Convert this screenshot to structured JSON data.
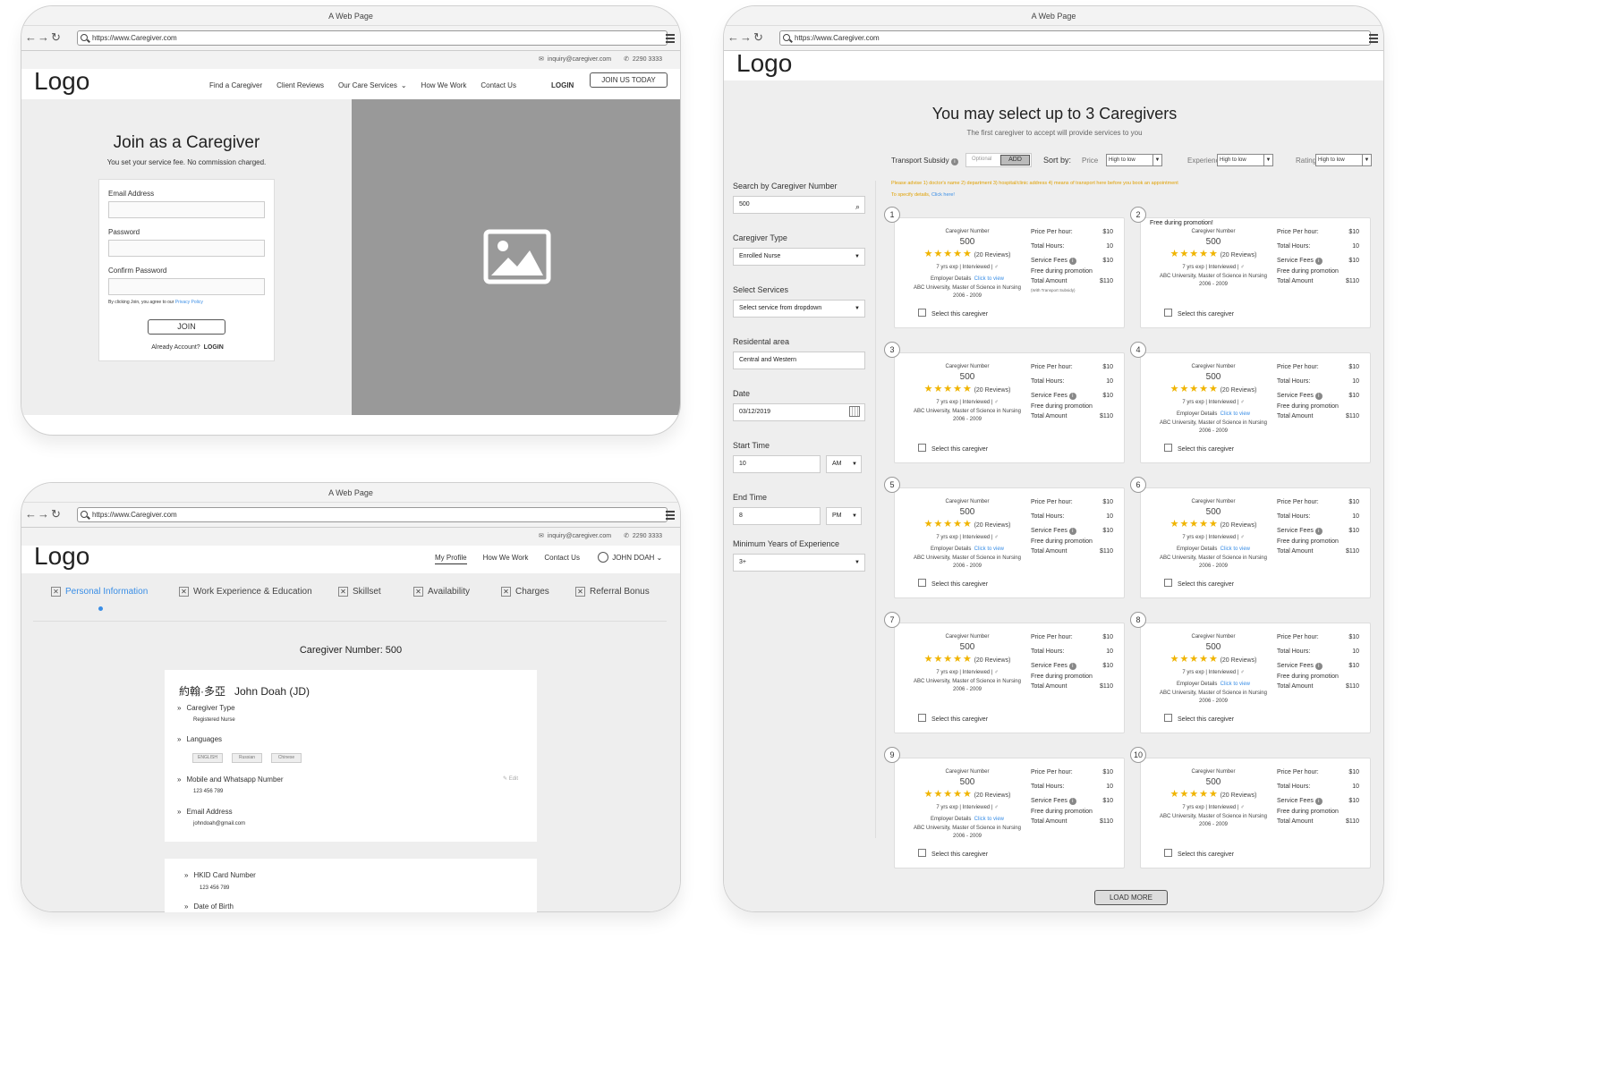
{
  "common": {
    "window_title": "A Web Page",
    "url": "https://www.Caregiver.com",
    "email": "inquiry@caregiver.com",
    "phone": "2290 3333",
    "logo": "Logo"
  },
  "join": {
    "nav": [
      "Find a Caregiver",
      "Client Reviews",
      "Our Care Services",
      "How We Work",
      "Contact Us"
    ],
    "login": "LOGIN",
    "join_today": "JOIN US TODAY",
    "title": "Join as a Caregiver",
    "subtitle": "You set your service fee. No commission charged.",
    "email_label": "Email Address",
    "password_label": "Password",
    "confirm_label": "Confirm Password",
    "terms": "By clicking Join, you agree to our",
    "privacy": "Privacy Policy",
    "join_btn": "JOIN",
    "already": "Already Account?",
    "login_link": "LOGIN"
  },
  "profile": {
    "nav": [
      "My Profile",
      "How We Work",
      "Contact Us"
    ],
    "user": "JOHN DOAH",
    "tabs": [
      "Personal Information",
      "Work Experience & Education",
      "Skillset",
      "Availability",
      "Charges",
      "Referral Bonus"
    ],
    "caregiver_number": "Caregiver Number: 500",
    "name": "約翰·多亞   John Doah (JD)",
    "type_label": "Caregiver Type",
    "type_value": "Registered Nurse",
    "lang_label": "Languages",
    "languages": [
      "ENGLISH",
      "Russian",
      "Chinese"
    ],
    "mobile_label": "Mobile and Whatsapp Number",
    "mobile_value": "123 456 789",
    "edit": "Edit",
    "email_label": "Email Address",
    "email_value": "johndoah@gmail.com",
    "hkid_label": "HKID Card Number",
    "hkid_value": "123 456 789",
    "dob_label": "Date of Birth"
  },
  "select": {
    "title": "You may select up to 3 Caregivers",
    "subtitle": "The first caregiver to accept will provide services to you",
    "transport": "Transport Subsidy",
    "optional": "Optional",
    "add": "ADD",
    "sort_by": "Sort by:",
    "price": "Price",
    "experience": "Experience",
    "ratings": "Ratings",
    "sort_value": "High to low",
    "advise": "Please advise 1) doctor's name 2) department 3) hospital/clinic address 4) means of transport here before you book an appointment",
    "specify": "To specify details,",
    "click_here": "Click here!",
    "side": {
      "search_label": "Search by Caregiver Number",
      "search_value": "500",
      "type_label": "Caregiver Type",
      "type_value": "Enrolled Nurse",
      "services_label": "Select Services",
      "services_value": "Select service from dropdown",
      "area_label": "Residental area",
      "area_value": "Central and Western",
      "date_label": "Date",
      "date_value": "03/12/2019",
      "start_label": "Start Time",
      "start_value": "10",
      "start_ampm": "AM",
      "end_label": "End Time",
      "end_value": "8",
      "end_ampm": "PM",
      "exp_label": "Minimum Years of Experience",
      "exp_value": "3+"
    },
    "card": {
      "cn_label": "Caregiver Number",
      "cn": "500",
      "reviews": "(20 Reviews)",
      "exp": "7 yrs exp  |  Interviewed  |  ♂",
      "employer": "Employer Details",
      "click_view": "Click to view",
      "edu": "ABC University, Master of Science in Nursing",
      "years": "2006 - 2009",
      "price_label": "Price Per hour:",
      "price": "$10",
      "hours_label": "Total Hours:",
      "hours": "10",
      "fee_label": "Service Fees",
      "fee": "$10",
      "promo": "Free during promotion",
      "total_label": "Total Amount",
      "total": "$110",
      "with_transport": "(With Transport Subsidy)",
      "select": "Select this caregiver",
      "free_banner": "Free during promotion!"
    },
    "card_numbers": [
      "1",
      "2",
      "3",
      "4",
      "5",
      "6",
      "7",
      "8",
      "9",
      "10"
    ],
    "load_more": "LOAD MORE"
  }
}
